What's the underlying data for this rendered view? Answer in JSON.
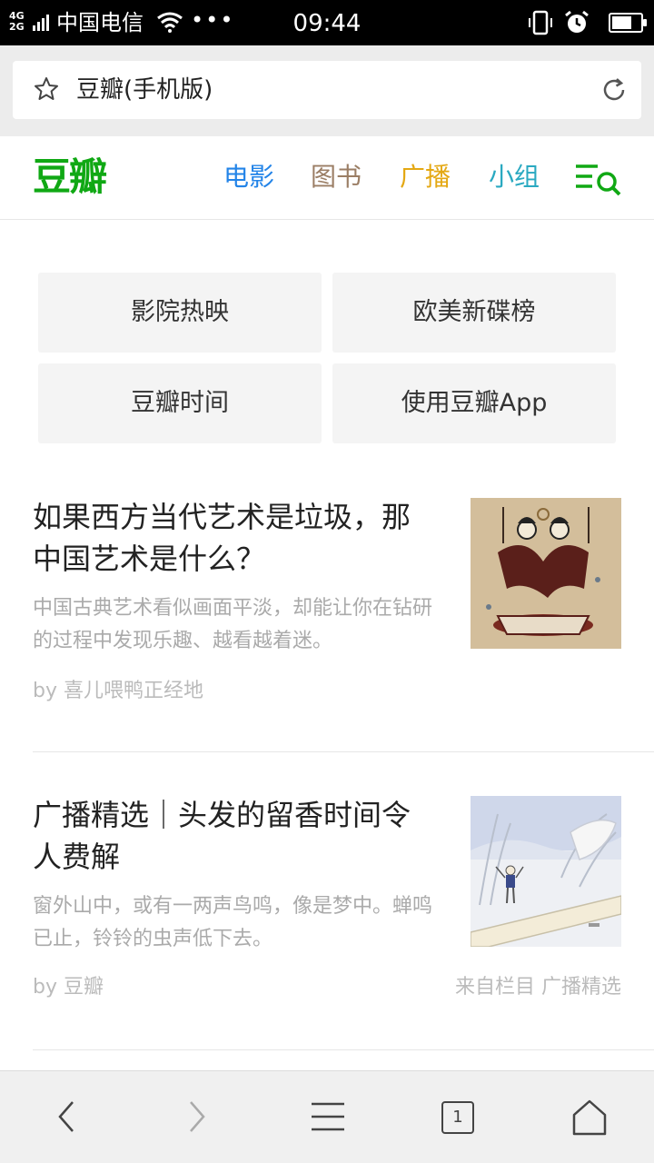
{
  "status_bar": {
    "network_top": "4G",
    "network_bottom": "2G",
    "carrier": "中国电信",
    "dots": "•••",
    "time": "09:44",
    "battery_level": 0.7
  },
  "browser": {
    "page_title": "豆瓣(手机版)",
    "tab_count": "1"
  },
  "site": {
    "logo": "豆瓣",
    "nav": [
      {
        "label": "电影",
        "color": "#2384e8"
      },
      {
        "label": "图书",
        "color": "#9b7e65"
      },
      {
        "label": "广播",
        "color": "#e4a813"
      },
      {
        "label": "小组",
        "color": "#2aa9c1"
      }
    ],
    "brand_color": "#10a814"
  },
  "quick_links": [
    "影院热映",
    "欧美新碟榜",
    "豆瓣时间",
    "使用豆瓣App"
  ],
  "feed": [
    {
      "title": "如果西方当代艺术是垃圾，那中国艺术是什么？",
      "desc": "中国古典艺术看似画面平淡，却能让你在钻研的过程中发现乐趣、越看越着迷。",
      "by": "by 喜儿喂鸭正经地",
      "source": ""
    },
    {
      "title": "广播精选｜头发的留香时间令人费解",
      "desc": "窗外山中，或有一两声鸟鸣，像是梦中。蝉鸣已止，铃铃的虫声低下去。",
      "by": "by 豆瓣",
      "source": "来自栏目 广播精选"
    }
  ]
}
